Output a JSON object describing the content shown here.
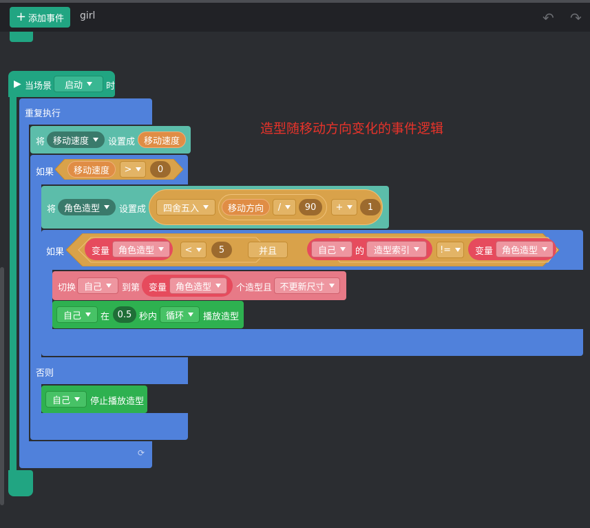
{
  "toolbar": {
    "add_event_label": "添加事件",
    "plus_icon": "+",
    "sprite_name": "girl",
    "undo_icon": "↶",
    "redo_icon": "↷"
  },
  "annotation": "造型随移动方向变化的事件逻辑",
  "hat": {
    "prefix": "当场景",
    "event_option": "启动",
    "suffix": "时"
  },
  "forever": {
    "label": "重复执行",
    "loop_icon": "⟳"
  },
  "set_speed": {
    "prefix": "将",
    "variable": "移动速度",
    "middle": "设置成",
    "value": "移动速度"
  },
  "if_outer": {
    "label": "如果",
    "left": "移动速度",
    "operator": ">",
    "right": "0",
    "else_label": "否则"
  },
  "set_costume_var": {
    "prefix": "将",
    "variable": "角色造型",
    "middle": "设置成",
    "round_op": "四舍五入",
    "direction": "移动方向",
    "div_op": "/",
    "divisor": "90",
    "plus_op": "+",
    "addend": "1"
  },
  "if_inner": {
    "label": "如果",
    "var_label": "变量",
    "var_name": "角色造型",
    "lt_op": "<",
    "limit": "5",
    "and_label": "并且",
    "self_option": "自己",
    "of_label": "的",
    "costume_index": "造型索引",
    "neq_op": "!=",
    "var_label2": "变量",
    "var_name2": "角色造型"
  },
  "switch_costume": {
    "prefix": "切换",
    "target": "自己",
    "to_label": "到第",
    "var_label": "变量",
    "var_name": "角色造型",
    "suffix": "个造型且",
    "size_option": "不更新尺寸"
  },
  "play_anim": {
    "target": "自己",
    "in_label": "在",
    "seconds": "0.5",
    "within_label": "秒内",
    "mode": "循环",
    "action": "播放造型"
  },
  "stop_anim": {
    "target": "自己",
    "action": "停止播放造型"
  }
}
